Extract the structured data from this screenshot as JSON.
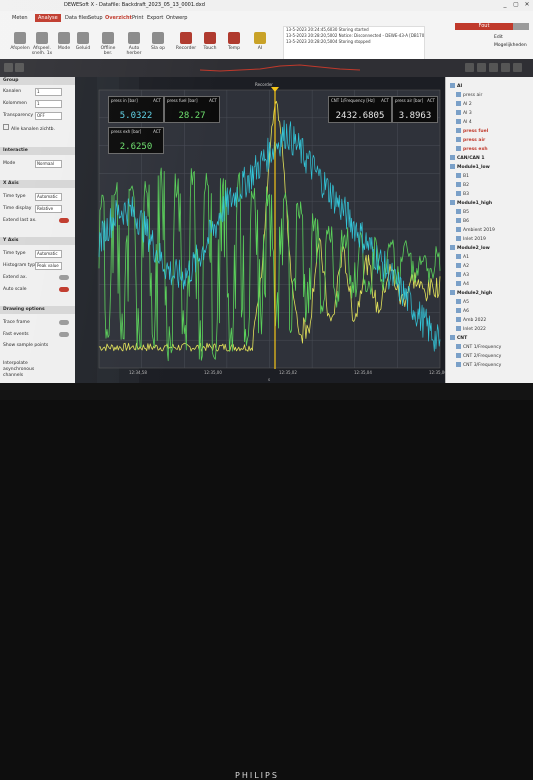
{
  "titlebar": {
    "title": "DEWESoft X - Datafile: Backdraft_2023_05_13_0001.dxd",
    "modes": [
      "Meten",
      "Analyse",
      "Data files",
      "Setup",
      "Overzicht",
      "Print",
      "Export",
      "Ontwerp"
    ],
    "active_mode": "Overzicht",
    "window_buttons": [
      "_",
      "▢",
      "✕"
    ]
  },
  "ribbon": {
    "buttons": [
      {
        "label": "Afspelen",
        "icon": "play-icon"
      },
      {
        "label": "Afspeel. snelh. 1x",
        "icon": "speed-icon"
      },
      {
        "label": "Mode",
        "icon": "mode-icon"
      },
      {
        "label": "Geluid",
        "icon": "sound-icon"
      },
      {
        "label": "Offline ber.",
        "icon": "calc-icon"
      },
      {
        "label": "Auto herber",
        "icon": "recalc-icon"
      },
      {
        "label": "Sla op",
        "icon": "save-icon"
      },
      {
        "label": "Recorder",
        "icon": "recorder-icon"
      },
      {
        "label": "Touch",
        "icon": "touch-icon"
      },
      {
        "label": "Temp",
        "icon": "temp-icon"
      },
      {
        "label": "AI",
        "icon": "ai-icon"
      }
    ],
    "log": [
      "13-5-2023 20:24:45,6030   Storing started",
      "13-5-2023 20:28:20,5002   Notice: Disconnected - DEWE-43-A [DB17006146]",
      "13-5-2023 20:28:20,5004   Storing stopped"
    ],
    "right_button": "Fout",
    "right_items": [
      "Edit",
      "Mogelijkheden"
    ]
  },
  "leftpanel": {
    "group_title": "Group",
    "rows": [
      {
        "label": "Kanalen",
        "value": "1"
      },
      {
        "label": "Kolommen",
        "value": "1"
      },
      {
        "label": "Transparency",
        "value": "OFF"
      }
    ],
    "checkbox_label": "Alle kanalen zichtb.",
    "sections": [
      "Interactie",
      "X Axis",
      "Y Axis",
      "Drawing options"
    ],
    "mode_label": "Mode",
    "mode_value": "Normaal",
    "xaxis_rows": [
      {
        "label": "Time type",
        "value": "Automatic"
      },
      {
        "label": "Time display",
        "value": "Relative"
      },
      {
        "label": "Extend last ax.",
        "value": ""
      }
    ],
    "yaxis_rows": [
      {
        "label": "Time type",
        "value": "Automatic"
      },
      {
        "label": "Histogram type",
        "value": "Peak value"
      },
      {
        "label": "Extend ax.",
        "value": ""
      },
      {
        "label": "Auto scale",
        "value": ""
      }
    ],
    "draw_rows": [
      "Trace frame",
      "Fast events",
      "Show sample points",
      "Interpolate asynchronous channels"
    ]
  },
  "graph": {
    "recorder_label": "Recorder",
    "time_unit": "s",
    "x_ticks": [
      "12:34,58",
      "12:35,00",
      "12:35,02",
      "12:35,04",
      "12:35,06"
    ],
    "readouts": [
      {
        "label": "press in [bar]",
        "act": "ACT",
        "value": "5.0322",
        "color": "#5fd3e8"
      },
      {
        "label": "press fuel [bar]",
        "act": "ACT",
        "value": "28.27",
        "color": "#6ee06e"
      },
      {
        "label": "press exh [bar]",
        "act": "ACT",
        "value": "2.6250",
        "color": "#6ee06e"
      },
      {
        "label": "CNT 1/Frequency [Hz]",
        "act": "ACT",
        "value": "2432.6805",
        "color": "#e8e8e8"
      },
      {
        "label": "press air [bar]",
        "act": "ACT",
        "value": "3.8963",
        "color": "#e8e8e8"
      }
    ],
    "colors": {
      "cyan": "#33c6d9",
      "green": "#5bd15b",
      "yellow": "#e2e25a",
      "cursor": "#f5c518"
    }
  },
  "channels": [
    {
      "label": "AI",
      "kind": "group"
    },
    {
      "label": "press air",
      "kind": "item"
    },
    {
      "label": "AI 2",
      "kind": "item"
    },
    {
      "label": "AI 3",
      "kind": "item"
    },
    {
      "label": "AI 4",
      "kind": "item"
    },
    {
      "label": "press fuel",
      "kind": "red"
    },
    {
      "label": "press air",
      "kind": "red"
    },
    {
      "label": "press exh",
      "kind": "red"
    },
    {
      "label": "CAN/CAN 1",
      "kind": "group"
    },
    {
      "label": "Module1_low",
      "kind": "group"
    },
    {
      "label": "B1",
      "kind": "item"
    },
    {
      "label": "B2",
      "kind": "item"
    },
    {
      "label": "B3",
      "kind": "item"
    },
    {
      "label": "Module1_high",
      "kind": "group"
    },
    {
      "label": "B5",
      "kind": "item"
    },
    {
      "label": "B6",
      "kind": "item"
    },
    {
      "label": "Ambient 2019",
      "kind": "item"
    },
    {
      "label": "Inlet 2019",
      "kind": "item"
    },
    {
      "label": "Module2_low",
      "kind": "group"
    },
    {
      "label": "A1",
      "kind": "item"
    },
    {
      "label": "A2",
      "kind": "item"
    },
    {
      "label": "A3",
      "kind": "item"
    },
    {
      "label": "A4",
      "kind": "item"
    },
    {
      "label": "Module2_high",
      "kind": "group"
    },
    {
      "label": "A5",
      "kind": "item"
    },
    {
      "label": "A6",
      "kind": "item"
    },
    {
      "label": "Amb 2022",
      "kind": "item"
    },
    {
      "label": "Inlet 2022",
      "kind": "item"
    },
    {
      "label": "CNT",
      "kind": "group"
    },
    {
      "label": "CNT 1/Frequency",
      "kind": "item"
    },
    {
      "label": "CNT 2/Frequency",
      "kind": "item"
    },
    {
      "label": "CNT 3/Frequency",
      "kind": "item"
    }
  ],
  "monitor": {
    "brand": "PHILIPS"
  }
}
